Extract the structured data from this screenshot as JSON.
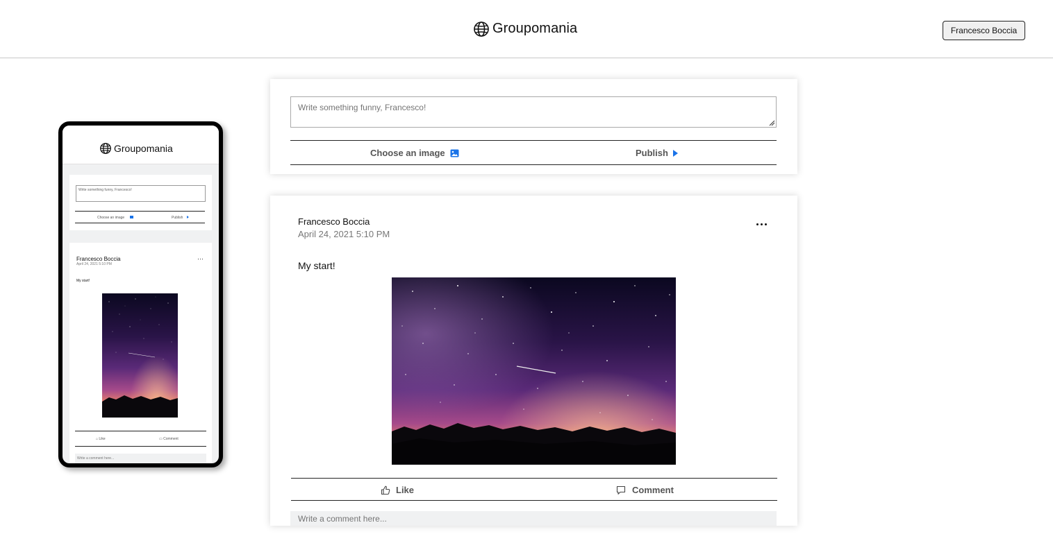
{
  "app": {
    "name": "Groupomania"
  },
  "header": {
    "user_button": "Francesco Boccia"
  },
  "create_post": {
    "placeholder": "Write something funny, Francesco!",
    "choose_image_label": "Choose an image",
    "publish_label": "Publish"
  },
  "post": {
    "author": "Francesco Boccia",
    "date": "April 24, 2021 5:10 PM",
    "content": "My start!",
    "image_alt": "starry-night-sky-photo",
    "like_label": "Like",
    "comment_label": "Comment",
    "comment_placeholder": "Write a comment here..."
  },
  "colors": {
    "accent": "#1a73e8",
    "text": "#111111",
    "muted": "#777777",
    "input_bg": "#f0f1f2"
  },
  "icons": {
    "brand": "globe-icon",
    "choose_image": "image-icon",
    "publish": "play-arrow-icon",
    "like": "thumbs-up-icon",
    "comment": "comment-icon",
    "menu": "more-dots-icon"
  }
}
